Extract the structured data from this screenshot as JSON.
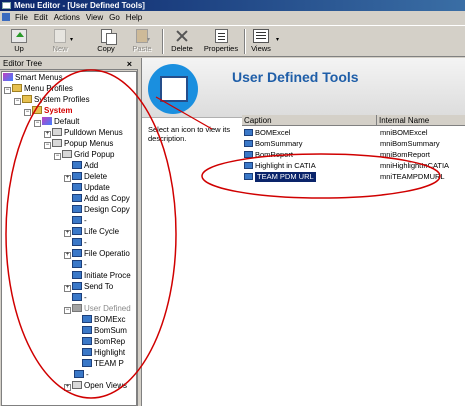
{
  "window": {
    "title": "Menu Editor - [User Defined Tools]"
  },
  "menubar": [
    "File",
    "Edit",
    "Actions",
    "View",
    "Go",
    "Help"
  ],
  "toolbar": {
    "up": "Up",
    "new": "New",
    "copy": "Copy",
    "paste": "Paste",
    "delete": "Delete",
    "properties": "Properties",
    "views": "Views"
  },
  "tree": {
    "header": "Editor Tree",
    "close_glyph": "×",
    "nodes": [
      "Smart Menus",
      "Menu Profiles",
      "System Profiles",
      "System",
      "Default",
      "Pulldown Menus",
      "Popup Menus",
      "Grid Popup",
      "Add",
      "Delete",
      "Update",
      "Add as Copy",
      "Design Copy",
      "-",
      "Life Cycle",
      "-",
      "File Operatio",
      "-",
      "Initiate Proce",
      "Send To",
      "-",
      "User Defined",
      "BOMExc",
      "BomSum",
      "BomRep",
      "Highlight",
      "TEAM P",
      "-",
      "Open Views"
    ]
  },
  "main": {
    "title": "User Defined Tools",
    "description": "Select an icon to view its description.",
    "columns": [
      "Caption",
      "Internal Name"
    ],
    "rows": [
      {
        "caption": "BOMExcel",
        "internal": "mniBOMExcel"
      },
      {
        "caption": "BomSummary",
        "internal": "mniBomSummary"
      },
      {
        "caption": "BomReport",
        "internal": "mniBomReport"
      },
      {
        "caption": "Highlight in CATIA",
        "internal": "mniHighlightInCATIA"
      },
      {
        "caption": "TEAM PDM URL",
        "internal": "mniTEAMPDMURL"
      }
    ]
  },
  "colors": {
    "annotation": "#d00000",
    "title_blue": "#1f5ea8",
    "selection": "#0a246a"
  }
}
